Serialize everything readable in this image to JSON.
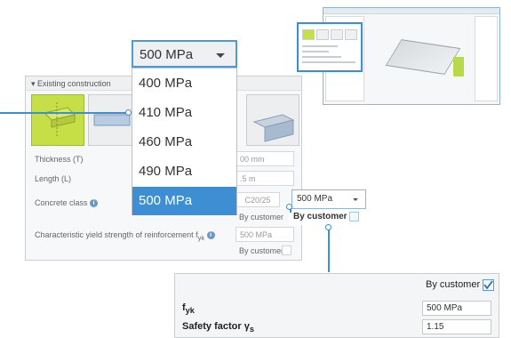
{
  "panel": {
    "section_title": "Existing construction",
    "thickness_label": "Thickness (T)",
    "length_label": "Length (L)",
    "thickness_value": "00 mm",
    "length_value": ".5 m",
    "concrete_class_label": "Concrete class",
    "concrete_class_value": "C20/25",
    "by_customer": "By customer",
    "yield_label": "Characteristic yield strength of reinforcement f",
    "yield_sub": "yk",
    "yield_value": "500 MPa"
  },
  "dropdown": {
    "selected": "500 MPa",
    "options": [
      "400 MPa",
      "410 MPa",
      "460 MPa",
      "490 MPa",
      "500 MPa"
    ]
  },
  "callout_small": {
    "value": "500 MPa",
    "by_customer": "By customer"
  },
  "callout_bottom": {
    "by_customer": "By customer",
    "fyk_label": "f",
    "fyk_sub": "yk",
    "fyk_value": "500 MPa",
    "safety_label": "Safety factor γ",
    "safety_sub": "s",
    "safety_value": "1.15"
  },
  "colors": {
    "accent": "#3d8ed3",
    "selected_tile": "#c6df46"
  }
}
